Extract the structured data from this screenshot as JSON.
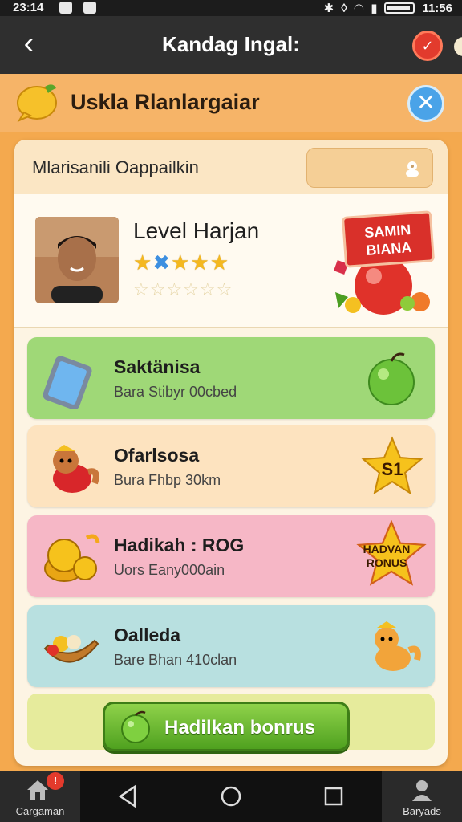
{
  "status_bar": {
    "time": "23:14",
    "clock": "11:56"
  },
  "app_bar": {
    "title": "Kandag Ingal:",
    "back_label": "‹"
  },
  "header": {
    "title": "Uskla Rlanlargaiar",
    "close_label": "✕"
  },
  "panel": {
    "head_title": "Mlarisanili Oappailkin",
    "profile": {
      "level_title": "Level Harjan",
      "promo_text": "SAMIN BIANA"
    },
    "rows": [
      {
        "title": "Saktänisa",
        "subtitle": "Bara Stibyr 00cbed",
        "bg": "#9fd877"
      },
      {
        "title": "Ofarlsosa",
        "subtitle": "Bura Fhbp 30km",
        "bg": "#fde3bf",
        "badge": "S1"
      },
      {
        "title": "Hadikah : ROG",
        "subtitle": "Uors Eany000ain",
        "bg": "#f6b7c6",
        "badge": "HADVAN RONUS"
      },
      {
        "title": "Oalleda",
        "subtitle": "Bare Bhan 410clan",
        "bg": "#b8e0e0"
      }
    ],
    "bonus_button": "Hadilkan bonrus"
  },
  "bottom_nav": {
    "left_label": "Cargaman",
    "left_badge": "!",
    "right_label": "Baryads"
  },
  "colors": {
    "background": "#f4a94e",
    "app_bar": "#2f2f2f",
    "header_band": "#f6b468",
    "accent_green": "#6cbf2e",
    "accent_red": "#e23b2d",
    "accent_blue": "#4aa3e8"
  }
}
